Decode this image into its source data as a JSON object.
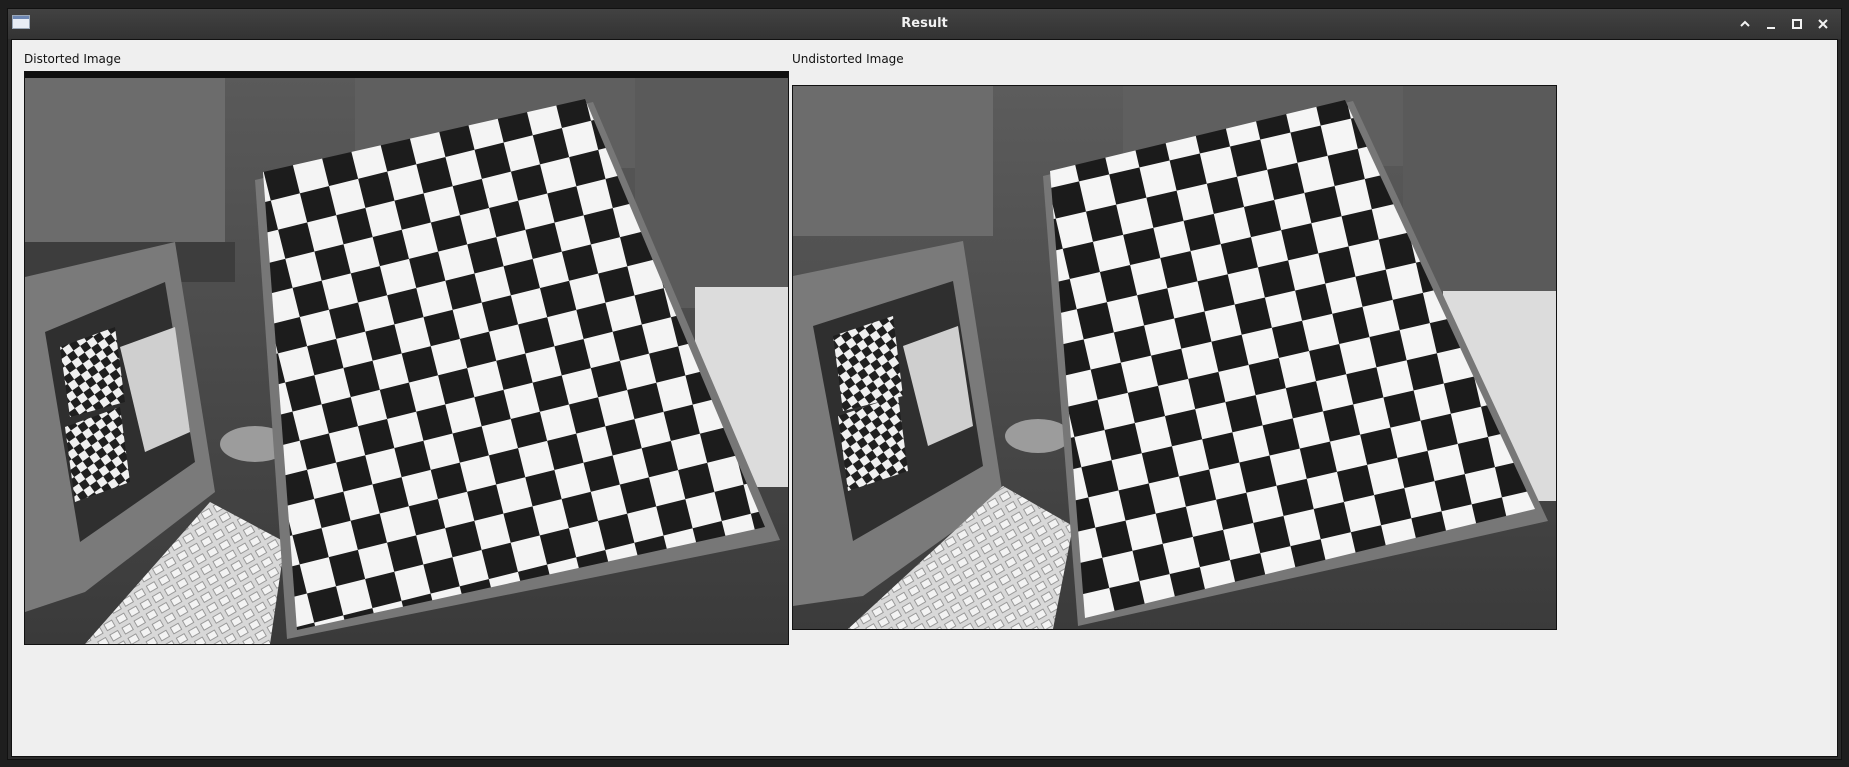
{
  "window": {
    "title": "Result"
  },
  "left_panel": {
    "title": "Distorted Image"
  },
  "right_panel": {
    "title": "Undistorted Image"
  },
  "icons": {
    "app": "window-app-icon",
    "controls": [
      "chevron-up-icon",
      "minimize-icon",
      "maximize-icon",
      "close-icon"
    ]
  },
  "colors": {
    "titlebar": "#3a3a3a",
    "content_bg": "#efefef"
  }
}
